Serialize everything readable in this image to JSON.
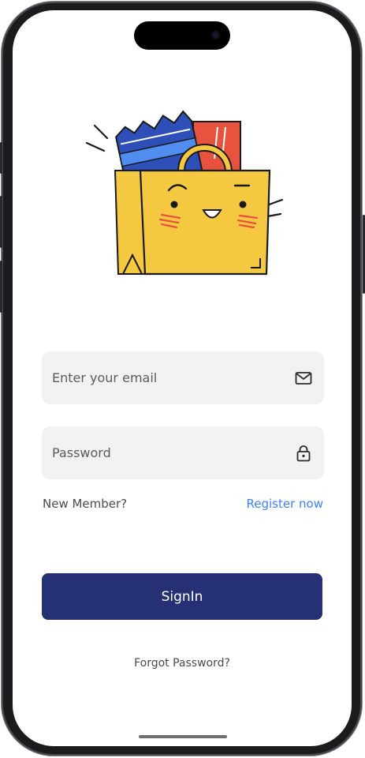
{
  "login": {
    "email_placeholder": "Enter your email",
    "password_placeholder": "Password",
    "new_member_label": "New Member?",
    "register_link": "Register now",
    "signin_button": "SignIn",
    "forgot_password_link": "Forgot Password?"
  },
  "icons": {
    "email": "mail-icon",
    "password": "lock-icon",
    "illustration": "shopping-bag-illustration"
  },
  "colors": {
    "primary": "#253174",
    "link": "#3b82f6",
    "field_bg": "#f2f2f2",
    "bag": "#f5c842",
    "bag_accent": "#e8533f",
    "ticket": "#2e4fb8"
  }
}
